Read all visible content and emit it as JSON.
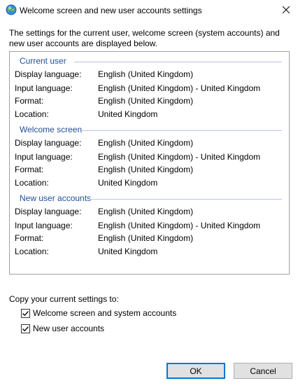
{
  "window": {
    "title": "Welcome screen and new user accounts settings",
    "icon": "globe-icon",
    "close_icon": "close-icon"
  },
  "intro_text": "The settings for the current user, welcome screen (system accounts) and new user accounts are displayed below.",
  "groups": [
    {
      "title": "Current user",
      "rows": [
        {
          "label": "Display language:",
          "value": "English (United Kingdom)"
        },
        {
          "label": "Input language:",
          "value": "English (United Kingdom) - United Kingdom"
        },
        {
          "label": "Format:",
          "value": "English (United Kingdom)"
        },
        {
          "label": "Location:",
          "value": "United Kingdom"
        }
      ]
    },
    {
      "title": "Welcome screen",
      "rows": [
        {
          "label": "Display language:",
          "value": "English (United Kingdom)"
        },
        {
          "label": "Input language:",
          "value": "English (United Kingdom) - United Kingdom"
        },
        {
          "label": "Format:",
          "value": "English (United Kingdom)"
        },
        {
          "label": "Location:",
          "value": "United Kingdom"
        }
      ]
    },
    {
      "title": "New user accounts",
      "rows": [
        {
          "label": "Display language:",
          "value": "English (United Kingdom)"
        },
        {
          "label": "Input language:",
          "value": "English (United Kingdom) - United Kingdom"
        },
        {
          "label": "Format:",
          "value": "English (United Kingdom)"
        },
        {
          "label": "Location:",
          "value": "United Kingdom"
        }
      ]
    }
  ],
  "copy_section": {
    "label": "Copy your current settings to:",
    "options": [
      {
        "label": "Welcome screen and system accounts",
        "checked": true
      },
      {
        "label": "New user accounts",
        "checked": true
      }
    ]
  },
  "buttons": {
    "ok": "OK",
    "cancel": "Cancel"
  },
  "colors": {
    "group_title": "#1e4e9c",
    "default_button_border": "#0078d7"
  }
}
